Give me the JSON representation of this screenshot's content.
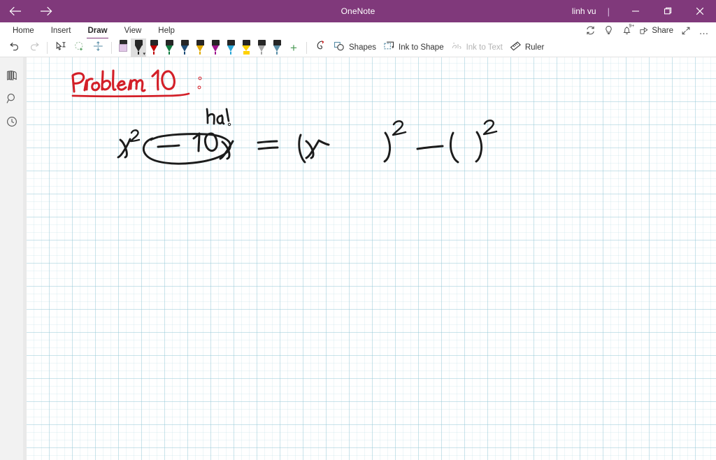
{
  "titlebar": {
    "app_title": "OneNote",
    "account_name": "linh vu",
    "divider": "|",
    "back_icon": "arrow-left-icon",
    "forward_icon": "arrow-right-icon",
    "minimize_label": "─",
    "restore_label": "❐",
    "close_label": "✕",
    "background_color": "#80397B"
  },
  "ribbon": {
    "tabs": [
      {
        "label": "Home",
        "active": false
      },
      {
        "label": "Insert",
        "active": false
      },
      {
        "label": "Draw",
        "active": true
      },
      {
        "label": "View",
        "active": false
      },
      {
        "label": "Help",
        "active": false
      }
    ],
    "active_tab": "Draw",
    "accent_color": "#80397B",
    "right_items": [
      {
        "name": "sync-icon",
        "label": ""
      },
      {
        "name": "lightbulb-icon",
        "label": ""
      },
      {
        "name": "notifications-bell-icon",
        "label": "",
        "badge": "9+"
      },
      {
        "name": "share-button",
        "label": "Share"
      },
      {
        "name": "expand-icon",
        "label": ""
      },
      {
        "name": "more-options-icon",
        "label": "…"
      }
    ]
  },
  "toolbar": {
    "undo_label": "Undo",
    "redo_label": "Redo",
    "lasso_select_label": "Lasso Select",
    "add_selection_label": "Add Selection",
    "insert_space_label": "Insert Space",
    "pens": [
      {
        "name": "eraser",
        "color": "#E2C8E8",
        "selected": false,
        "type": "eraser"
      },
      {
        "name": "pen-black",
        "color": "#1c1c1c",
        "selected": true,
        "type": "pen"
      },
      {
        "name": "pen-red",
        "color": "#C00000",
        "selected": false,
        "type": "pen"
      },
      {
        "name": "pen-green",
        "color": "#107C41",
        "selected": false,
        "type": "pen"
      },
      {
        "name": "pen-blue",
        "color": "#1F4E79",
        "selected": false,
        "type": "pen"
      },
      {
        "name": "pen-yellow",
        "color": "#E0A800",
        "selected": false,
        "type": "pen"
      },
      {
        "name": "pen-magenta",
        "color": "#A0158F",
        "selected": false,
        "type": "pen"
      },
      {
        "name": "pen-cyan",
        "color": "#2AA6D6",
        "selected": false,
        "type": "pen"
      },
      {
        "name": "highlighter-yellow",
        "color": "#FFD100",
        "selected": false,
        "type": "highlighter"
      },
      {
        "name": "pen-silver",
        "color": "#A6A6A6",
        "selected": false,
        "type": "pen"
      },
      {
        "name": "pen-steel-blue",
        "color": "#5B8FA8",
        "selected": false,
        "type": "pen"
      }
    ],
    "add_pen_label": "+",
    "ink_eraser_label": "Ink Eraser",
    "shapes_label": "Shapes",
    "ink_to_shape_label": "Ink to Shape",
    "ink_to_text_label": "Ink to Text",
    "ink_to_text_enabled": false,
    "ruler_label": "Ruler"
  },
  "rail": {
    "items": [
      {
        "name": "notebooks-icon",
        "label": "Notebooks"
      },
      {
        "name": "search-icon",
        "label": "Search"
      },
      {
        "name": "recent-notes-clock-icon",
        "label": "Recent Notes"
      }
    ]
  },
  "canvas": {
    "grid_color": "#96C8D7",
    "background_color": "#FFFFFF",
    "ink_notes": [
      {
        "name": "problem-heading",
        "text": "Problem 10:",
        "color": "#D31F28",
        "underlined": true
      },
      {
        "name": "annotation-ha",
        "text": "ha!",
        "color": "#1c1c1c"
      },
      {
        "name": "equation-left",
        "text": "x² − 10x",
        "color": "#1c1c1c",
        "circled_part": "− 10x"
      },
      {
        "name": "equation-right",
        "text": "= (x  )² − (  )²",
        "color": "#1c1c1c"
      }
    ],
    "full_equation": "x² − 10x = (x )² − ( )²"
  }
}
